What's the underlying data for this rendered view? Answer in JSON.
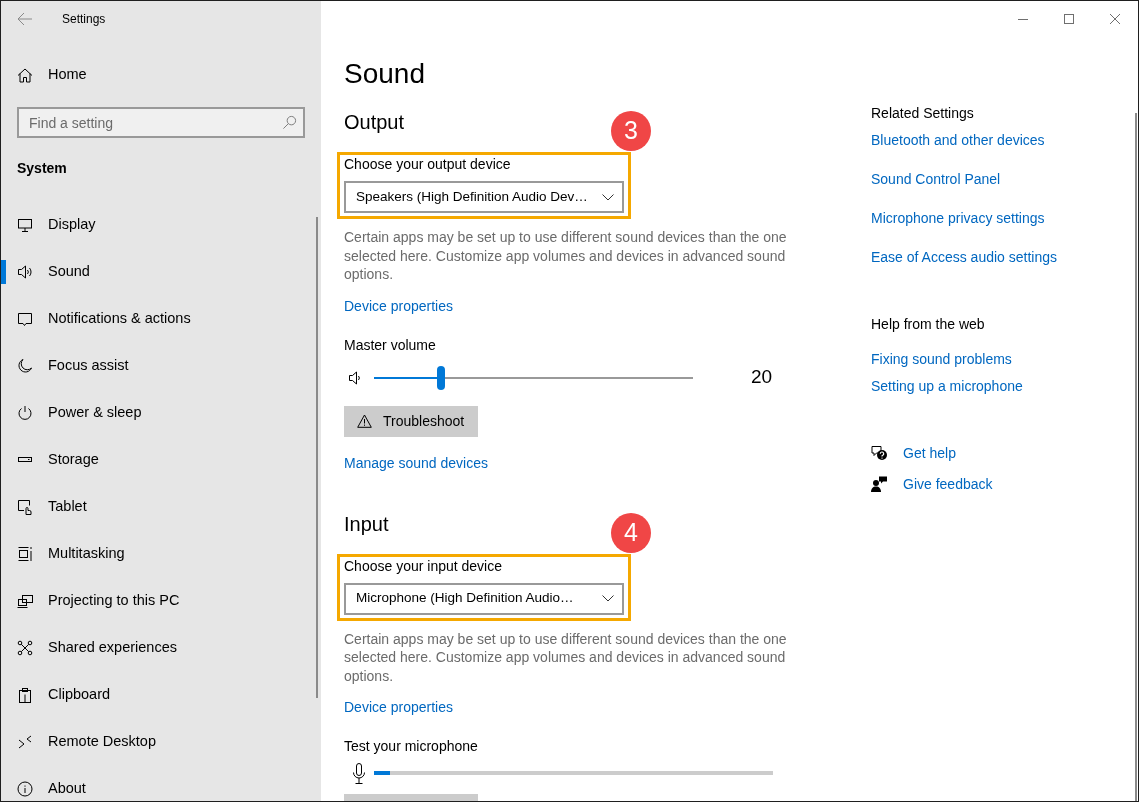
{
  "window": {
    "title": "Settings"
  },
  "sidebar": {
    "home": "Home",
    "search": {
      "placeholder": "Find a setting"
    },
    "section": "System",
    "items": [
      {
        "kind": "display",
        "label": "Display",
        "selected": false
      },
      {
        "kind": "sound",
        "label": "Sound",
        "selected": true
      },
      {
        "kind": "notifications",
        "label": "Notifications & actions",
        "selected": false
      },
      {
        "kind": "focus",
        "label": "Focus assist",
        "selected": false
      },
      {
        "kind": "power",
        "label": "Power & sleep",
        "selected": false
      },
      {
        "kind": "storage",
        "label": "Storage",
        "selected": false
      },
      {
        "kind": "tablet",
        "label": "Tablet",
        "selected": false
      },
      {
        "kind": "multitasking",
        "label": "Multitasking",
        "selected": false
      },
      {
        "kind": "projecting",
        "label": "Projecting to this PC",
        "selected": false
      },
      {
        "kind": "shared",
        "label": "Shared experiences",
        "selected": false
      },
      {
        "kind": "clipboard",
        "label": "Clipboard",
        "selected": false
      },
      {
        "kind": "remote",
        "label": "Remote Desktop",
        "selected": false
      },
      {
        "kind": "about",
        "label": "About",
        "selected": false
      }
    ]
  },
  "page": {
    "title": "Sound"
  },
  "sections": [
    {
      "heading": "Output",
      "step": "3",
      "device": {
        "label": "Choose your output device",
        "value": "Speakers (High Definition Audio Dev…"
      },
      "note": "Certain apps may be set up to use different sound devices than the one selected here. Customize app volumes and devices in advanced sound options.",
      "link": "Device properties",
      "volume": {
        "kind": "slider",
        "label": "Master volume",
        "level": 0.21,
        "reading": "20"
      },
      "button": "Troubleshoot",
      "extra_link": "Manage sound devices"
    },
    {
      "heading": "Input",
      "step": "4",
      "device": {
        "label": "Choose your input device",
        "value": "Microphone (High Definition Audio…"
      },
      "note": "Certain apps may be set up to use different sound devices than the one selected here. Customize app volumes and devices in advanced sound options.",
      "link": "Device properties",
      "volume": {
        "kind": "meter",
        "label": "Test your microphone",
        "level": 0.04
      },
      "cut_off_button": true
    }
  ],
  "related": {
    "heading": "Related Settings",
    "links": [
      "Bluetooth and other devices",
      "Sound Control Panel",
      "Microphone privacy settings",
      "Ease of Access audio settings"
    ]
  },
  "help": {
    "heading": "Help from the web",
    "links": [
      "Fixing sound problems",
      "Setting up a microphone"
    ]
  },
  "support": [
    {
      "kind": "help",
      "label": "Get help"
    },
    {
      "kind": "feedback",
      "label": "Give feedback"
    }
  ]
}
